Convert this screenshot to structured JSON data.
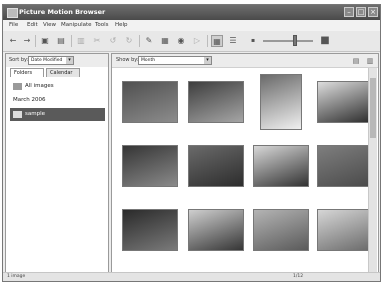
{
  "window": {
    "title": "Picture Motion Browser"
  },
  "menu": [
    "File",
    "Edit",
    "View",
    "Manipulate",
    "Tools",
    "Help"
  ],
  "left_panel": {
    "sort_label": "Sort by:",
    "sort_value": "Date Modified",
    "tabs": [
      "Folders",
      "Calendar"
    ],
    "folders": [
      "All images",
      "March 2006",
      "sample"
    ],
    "selected_folder": "sample"
  },
  "main": {
    "show_label": "Show by:",
    "show_value": "Month"
  },
  "thumbnails": [
    {
      "name": "thumb-snowy-trees",
      "colors": [
        "#505050",
        "#8c8c8c"
      ]
    },
    {
      "name": "thumb-snowfield",
      "colors": [
        "#3e3e3e",
        "#a5a5a5"
      ]
    },
    {
      "name": "thumb-snowman",
      "colors": [
        "#6a6a6a",
        "#f0f0f0"
      ]
    },
    {
      "name": "thumb-snow-skiers",
      "colors": [
        "#dddddd",
        "#2c2c2c"
      ]
    },
    {
      "name": "thumb-cat-1",
      "colors": [
        "#353535",
        "#8a8a8a"
      ]
    },
    {
      "name": "thumb-cat-2",
      "colors": [
        "#6a6a6a",
        "#2d2d2d"
      ]
    },
    {
      "name": "thumb-dalmatian",
      "colors": [
        "#d8d8d8",
        "#333333"
      ]
    },
    {
      "name": "thumb-kitten",
      "colors": [
        "#7e7e7e",
        "#4a4a4a"
      ]
    },
    {
      "name": "thumb-beach-dark",
      "colors": [
        "#2a2a2a",
        "#7a7a7a"
      ]
    },
    {
      "name": "thumb-mountain-sea",
      "colors": [
        "#cfcfcf",
        "#363636"
      ]
    },
    {
      "name": "thumb-coast",
      "colors": [
        "#b4b4b4",
        "#5a5a5a"
      ]
    },
    {
      "name": "thumb-wave",
      "colors": [
        "#d6d6d6",
        "#6a6a6a"
      ]
    }
  ],
  "status": {
    "left": "1 image",
    "right": "1/12"
  }
}
